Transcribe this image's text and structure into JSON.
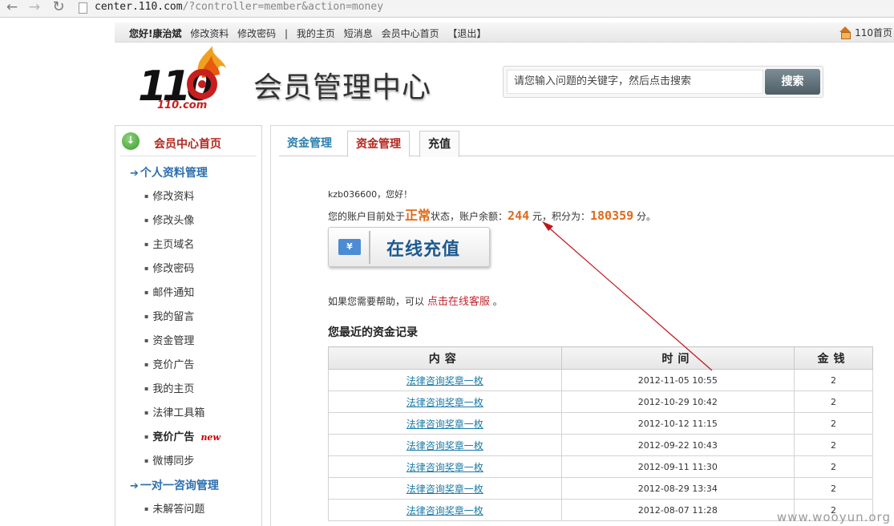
{
  "browser": {
    "url_host": "center.110.com",
    "url_path": "/?controller=member&action=money"
  },
  "topbar": {
    "greeting": "您好!",
    "username": "康治斌",
    "links": [
      "修改资料",
      "修改密码",
      "|",
      "我的主页",
      "短消息",
      "会员中心首页",
      "【退出】"
    ],
    "home_label": "110首页"
  },
  "header": {
    "title": "会员管理中心",
    "search_placeholder": "请您输入问题的关键字，然后点击搜索",
    "search_button": "搜索"
  },
  "logo": {
    "text": "110",
    "domain": "110.com"
  },
  "sidebar": {
    "home_label": "会员中心首页",
    "section1": "个人资料管理",
    "items": [
      "修改资料",
      "修改头像",
      "主页域名",
      "修改密码",
      "邮件通知",
      "我的留言",
      "资金管理",
      "竞价广告",
      "我的主页",
      "法律工具箱",
      "竞价广告",
      "微博同步"
    ],
    "new_badge": "new",
    "section2": "一对一咨询管理",
    "items2": [
      "未解答问题"
    ]
  },
  "tabs": [
    "资金管理",
    "资金管理",
    "充值"
  ],
  "account": {
    "greeting": "kzb036600，您好！",
    "status_prefix": "您的账户目前处于",
    "status": "正常",
    "balance_prefix": "状态，账户余额：",
    "balance": "244",
    "balance_unit": "元，积分为：",
    "points": "180359",
    "points_unit": "分。"
  },
  "recharge_button": "在线充值",
  "recharge_icon": "¥",
  "help": {
    "prefix": "如果您需要帮助，可以",
    "link": "点击在线客服",
    "suffix": "。"
  },
  "records": {
    "title": "您最近的资金记录",
    "headers": [
      "内容",
      "时间",
      "金钱"
    ],
    "rows": [
      {
        "content": "法律咨询奖章一枚",
        "time": "2012-11-05 10:55",
        "amount": "2"
      },
      {
        "content": "法律咨询奖章一枚",
        "time": "2012-10-29 10:42",
        "amount": "2"
      },
      {
        "content": "法律咨询奖章一枚",
        "time": "2012-10-12 11:15",
        "amount": "2"
      },
      {
        "content": "法律咨询奖章一枚",
        "time": "2012-09-22 10:43",
        "amount": "2"
      },
      {
        "content": "法律咨询奖章一枚",
        "time": "2012-09-11 11:30",
        "amount": "2"
      },
      {
        "content": "法律咨询奖章一枚",
        "time": "2012-08-29 13:34",
        "amount": "2"
      },
      {
        "content": "法律咨询奖章一枚",
        "time": "2012-08-07 11:28",
        "amount": "2"
      }
    ]
  },
  "watermark": "www.wooyun.org",
  "colors": {
    "accent_red": "#b3261e",
    "link_blue": "#2d6fae",
    "highlight_orange": "#e06a1a",
    "annotation_arrow": "#c0141a"
  }
}
